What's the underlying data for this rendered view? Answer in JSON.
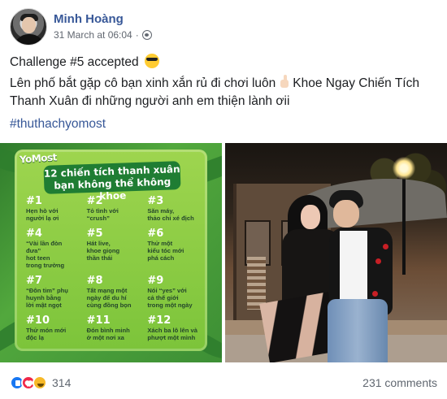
{
  "author": {
    "name": "Minh Hoàng",
    "timestamp": "31 March at 06:04",
    "privacy_icon": "globe-icon"
  },
  "post": {
    "line1": "Challenge #5 accepted",
    "line2_part1": "Lên phố bắt gặp cô bạn xinh xắn rủ đi chơi luôn",
    "line2_part2": "Khoe Ngay Chiến Tích Thanh Xuân đi những người anh em thiện lành ơii",
    "hashtag": "#thuthachyomost",
    "emoji": [
      "sunglasses-face-emoji",
      "pointing-hand-emoji"
    ]
  },
  "image_left": {
    "brand": "YoMost",
    "banner_title": "12 chiến tích thanh xuân bạn không thể không khoe",
    "items": [
      {
        "num": "#1",
        "text": "Hẹn hò với\nngười lạ ơi"
      },
      {
        "num": "#2",
        "text": "Tỏ tình với\n“crush”"
      },
      {
        "num": "#3",
        "text": "Săn máy,\nthảo chỉ xé địch"
      },
      {
        "num": "#4",
        "text": "“Vài lần đòn đưa”\nhot teen\ntrong trường"
      },
      {
        "num": "#5",
        "text": "Hát live,\nkhoe giọng\nthần thái"
      },
      {
        "num": "#6",
        "text": "Thử một\nkiểu tóc mới\nphá cách"
      },
      {
        "num": "#7",
        "text": "“Đôn tim” phụ\nhuynh bằng\nlời mật ngọt"
      },
      {
        "num": "#8",
        "text": "Tất mạng một\nngày để du hí\ncùng đồng bọn"
      },
      {
        "num": "#9",
        "text": "Nói “yes” với\ncả thế giới\ntrong một ngày"
      },
      {
        "num": "#10",
        "text": "Thử món mới\nđộc lạ"
      },
      {
        "num": "#11",
        "text": "Đón bình minh\nở một nơi xa"
      },
      {
        "num": "#12",
        "text": "Xách ba lô lên và\nphượt một mình"
      }
    ]
  },
  "image_right": {
    "description_icon": "couple-photo"
  },
  "footer": {
    "reaction_count": "314",
    "comments": "231 comments",
    "reaction_icons": [
      "like-reaction-icon",
      "love-reaction-icon",
      "haha-reaction-icon"
    ]
  },
  "colors": {
    "link": "#385898",
    "secondary_text": "#616770",
    "green_card": "#7cc43a",
    "banner": "#1f7d33"
  }
}
